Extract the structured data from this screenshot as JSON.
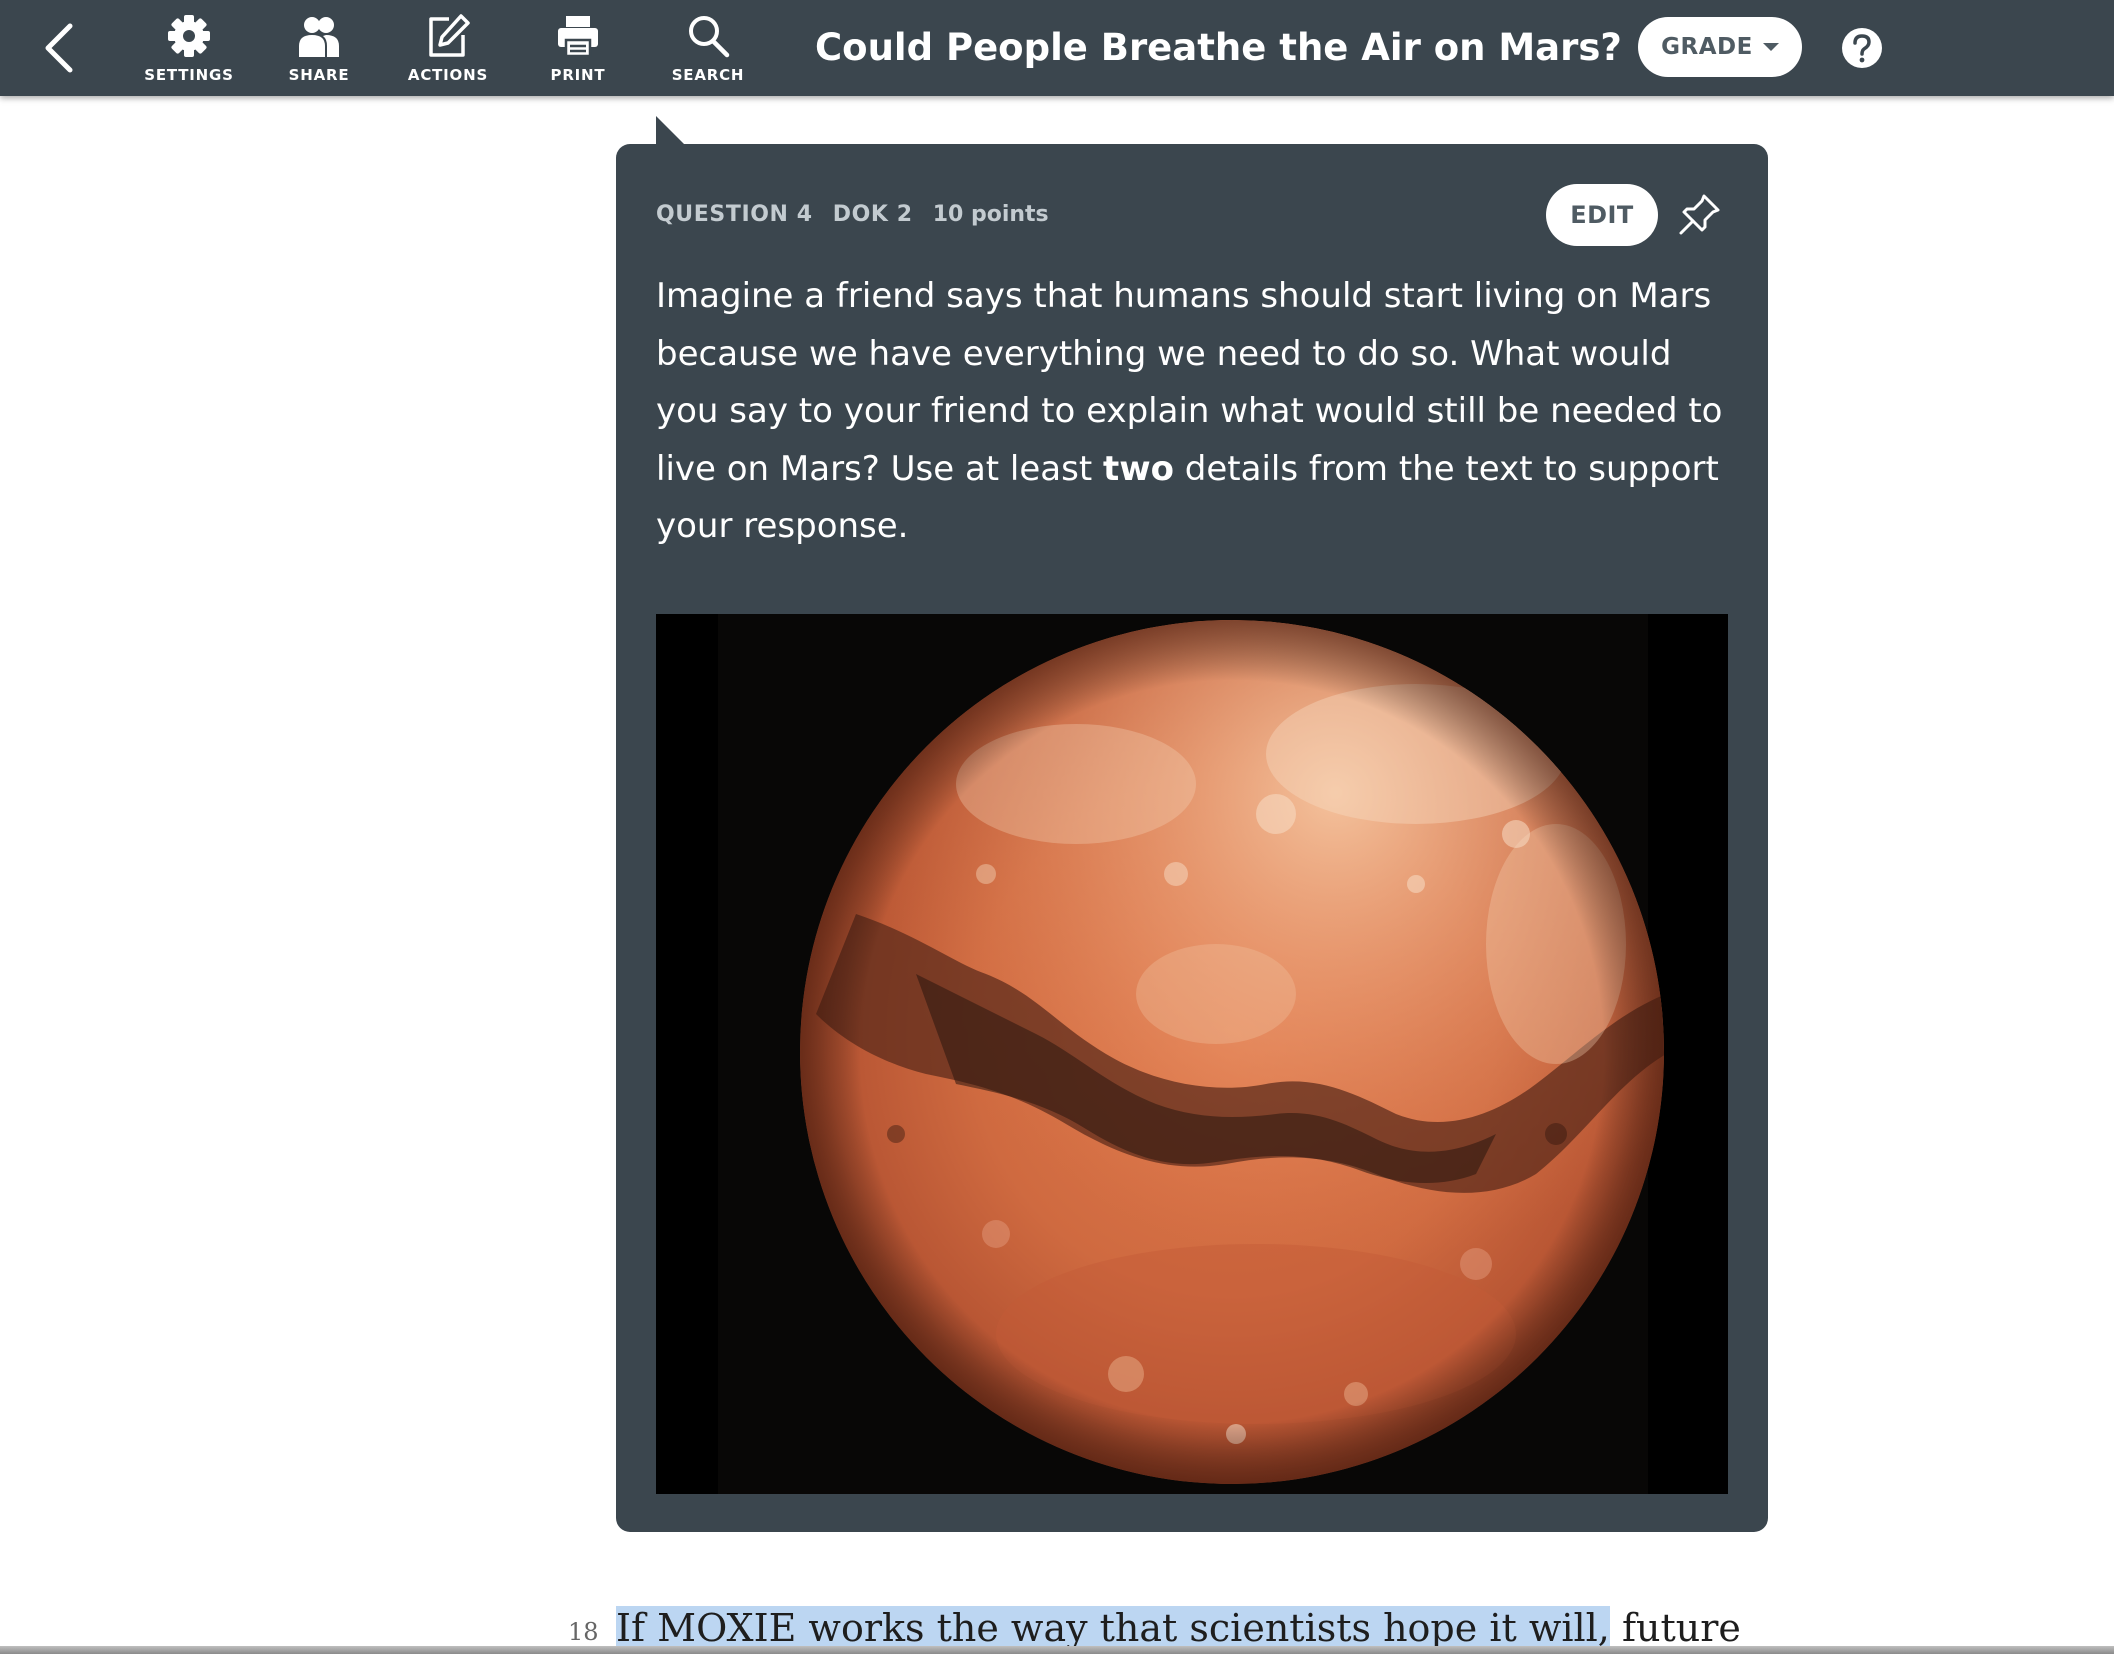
{
  "toolbar": {
    "back_icon": "chevron-left-icon",
    "tools": [
      {
        "label": "SETTINGS",
        "icon": "gear-icon"
      },
      {
        "label": "SHARE",
        "icon": "people-icon"
      },
      {
        "label": "ACTIONS",
        "icon": "edit-note-icon"
      },
      {
        "label": "PRINT",
        "icon": "printer-icon"
      },
      {
        "label": "SEARCH",
        "icon": "magnifier-icon"
      }
    ],
    "title": "Could People Breathe the Air on Mars?",
    "grade_label": "GRADE",
    "grade_icon": "caret-down-icon",
    "help_icon": "question-circle-icon"
  },
  "question": {
    "number": "QUESTION 4",
    "dok": "DOK 2",
    "points": "10 points",
    "edit_label": "EDIT",
    "pin_icon": "pin-icon",
    "text_before": "Imagine a friend says that humans should start living on Mars because we have everything we need to do so. What would you say to your friend to explain what would still be needed to live on Mars? Use at least ",
    "text_bold": "two",
    "text_after": " details from the text to support your response.",
    "image": "mars-planet-image"
  },
  "passage": {
    "line_number": "18",
    "highlighted": "If MOXIE works the way that scientists hope it will,",
    "rest": " future"
  },
  "colors": {
    "toolbar_bg": "#3b464e",
    "card_bg": "#3b464e",
    "highlight": "#bcd6f2",
    "button_text": "#4f5b63"
  }
}
